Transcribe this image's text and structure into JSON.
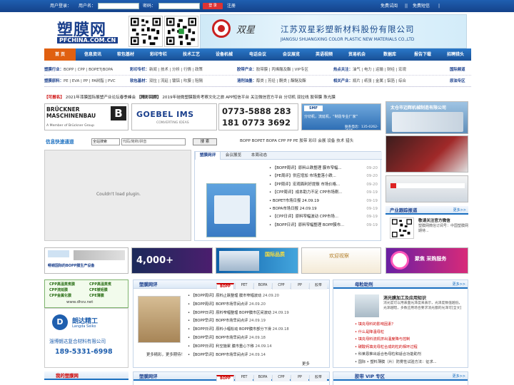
{
  "topbar": {
    "login": "用户登录：",
    "username_label": "用户名：",
    "password_label": "密码：",
    "login_btn": "登 录",
    "register": "注册",
    "free_trial": "免费试阅",
    "free_sms": "免费短信"
  },
  "logo": {
    "main": "塑膜网",
    "sub": "PFCHINA.COM.CN"
  },
  "banner": {
    "company": "江苏双星彩塑新材料股份有限公司",
    "company_en": "JIANGSU SHUANGXING COLOR PLASTIC NEW MATERIALS CO.,LTD",
    "brand": "双星"
  },
  "nav": [
    "首 页",
    "信息资讯",
    "软包基材",
    "彩印专栏",
    "技术工艺",
    "设备机械",
    "电话会议",
    "会议展览",
    "英语视频",
    "贸易机会",
    "数据库",
    "报告下载",
    "招聘猎头"
  ],
  "subnav": {
    "r1": [
      {
        "k": "塑膜行业：",
        "v": "BOPP | CPP | BOPET|BOPA"
      },
      {
        "k": "彩印专栏：",
        "v": "新闻 | 技术 | 分析 | 行情 | 政策"
      },
      {
        "k": "胶带产业：",
        "v": "胶带膜 | 丙烯酸及酯 | VIP专区"
      },
      {
        "k": "热点关注：",
        "v": "油气 | 电力 | 运输 | 财经 | 宏观"
      },
      {
        "k": "国际频道",
        "v": ""
      }
    ],
    "r2": [
      {
        "k": "塑膜原料：",
        "v": "PE | EVA | PP | PA树脂 | PVC"
      },
      {
        "k": "软包基材：",
        "v": "双拉 | 流延 | 镀铝 | 吹膜 | 阻隔"
      },
      {
        "k": "溶剂油墨：",
        "v": "醇类 | 芳烃 | 酮类 | 酯醚及酯"
      },
      {
        "k": "相关产业：",
        "v": "瓶片 | 纸张 | 金属 | 铝箔 | 综合"
      },
      {
        "k": "原油专区",
        "v": ""
      }
    ]
  },
  "promo": {
    "red": "【可报名】",
    "items": [
      "2021年漆膜国际展塑产业论坛春季峰会",
      "【精彩回顾】",
      "2019年硅微塑膜服务考察文化之旅",
      "APP短信平台",
      "关注微信官方平台",
      "分切机",
      "双拉线",
      "胶带膜",
      "珠光膜"
    ]
  },
  "ads_row1": {
    "bruckner": "BRÜCKNER MASCHINENBAU",
    "bruckner_sub": "A Member of Brückner Group",
    "goebel": "GOEBEL IMS",
    "goebel_sub": "CONVERTING IDEAS",
    "phone1": "0773-5888 283",
    "phone2": "181 0773 3692",
    "smf_text": "分切机，流延机，“制造专业厂家”",
    "smf_phone": "联系电话：135-0262-2505",
    "right_company": "太仓市迈辉机械制造有限公司"
  },
  "quick": {
    "title": "信息快速通道",
    "select": "全站搜索",
    "input": "代码/简称/拼音",
    "search_btn": "搜 索"
  },
  "plugin": "Couldn't load plugin.",
  "tags": "BOPP BOPET BOPA CPP PP PE 胶带 彩印 会展 设备 技术 猎头",
  "center_tabs": [
    "塑膜网评",
    "会议展览",
    "本周动态"
  ],
  "news": [
    {
      "t": "【BOPP周评】原料止跌整理 膜市窄幅...",
      "d": "09-20"
    },
    {
      "t": "【PE周评】供应增加 市场重落小跌...",
      "d": "09-20"
    },
    {
      "t": "【PP周评】宏观面利好提振 市场价格...",
      "d": "09-20"
    },
    {
      "t": "【CPP周评】成本助力不足 CPP市场刚...",
      "d": "09-19"
    },
    {
      "t": "BOPET市场日报 24.09.19",
      "d": "09-19"
    },
    {
      "t": "BOPA市场日报 24.09.19",
      "d": "09-19"
    },
    {
      "t": "【CPP日评】原料窄幅波动 CPP市场...",
      "d": "09-19"
    },
    {
      "t": "【BOPP日评】原料窄幅整理 BOPP膜市...",
      "d": "09-19"
    }
  ],
  "wechat": {
    "title": "敬请关注官方微信",
    "body": "塑膜网微信订阅号：中国塑膜网 期待..."
  },
  "right_sections": {
    "industry_report": "产业跟踪报道",
    "more": "更多>>"
  },
  "ads_row2": {
    "a1": "畅销国际的BOPP膜生产设备",
    "a2": "4,000+",
    "a3": "国际品质",
    "a4": "欢迎视察",
    "a5": "聚焦 采购服务"
  },
  "left_bottom": {
    "box_lines": [
      "CPP高温蒸煮膜",
      "CPP流延膜",
      "CPP金属化膜",
      "CPP高温蒸煮",
      "CPE镀铝膜",
      "CPE薄膜"
    ],
    "url": "www.dhsv.net",
    "langda": "朗达精工",
    "langda_en": "Langda Seiko",
    "company": "淄博朗达复合材料有限公司",
    "phone": "189-5331-6998",
    "mynet": "我的塑膜网"
  },
  "review": {
    "title": "塑膜网评",
    "tabs": [
      "BOPP",
      "PET",
      "BOPA",
      "CPP",
      "PP",
      "胶带"
    ],
    "more": "更多",
    "caption": "更多精彩，更多期待！",
    "items": [
      {
        "t": "【BOPP周评】原料止跌整理 膜市窄幅波动",
        "d": "24.09.20"
      },
      {
        "t": "【BOPP周评】BOPP市场早间点评",
        "d": "24.09.20"
      },
      {
        "t": "【BOPP日评】原料窄幅整理 BOPP膜市区间波动",
        "d": "24.09.19"
      },
      {
        "t": "【BOPP早评】BOPP市场早间点评",
        "d": "24.09.19"
      },
      {
        "t": "【BOPP日评】原料小幅松动 BOPP膜市部分下滑",
        "d": "24.09.18"
      },
      {
        "t": "【BOPP早评】BOPP市场早间点评",
        "d": "24.09.18"
      },
      {
        "t": "【BOPP日评】利空施累 膜市重心下移",
        "d": "24.09.14"
      },
      {
        "t": "【BOPP早评】BOPP市场早间点评",
        "d": "24.09.14"
      }
    ]
  },
  "mother": {
    "title": "母粒助剂",
    "more": "更多>>",
    "headline": "消光膜加工及应用知识",
    "intro": "消光度可以用表面光泽度来表示，光泽度数值越低，光泽越暗，多数应用场合要求消光膜的光泽可[全文]",
    "items": [
      "填充母料的影响因素？",
      "什么是降温母粒",
      "填充母料流机挤出温度降与控制",
      "碳酸钙填充母粒合成的粒的相环过程",
      "科莱恩推出适合色母粒和适合功能助剂",
      "国际 • 塑料薄膜（片）防雾性试验方法：征求..."
    ]
  },
  "review2": {
    "title": "塑膜网评",
    "tabs": [
      "BOPP",
      "PET",
      "BOPA",
      "CPP",
      "PP",
      "胶带"
    ]
  },
  "vip": {
    "title": "胶带 VIP 专区",
    "more": "更多>>"
  }
}
